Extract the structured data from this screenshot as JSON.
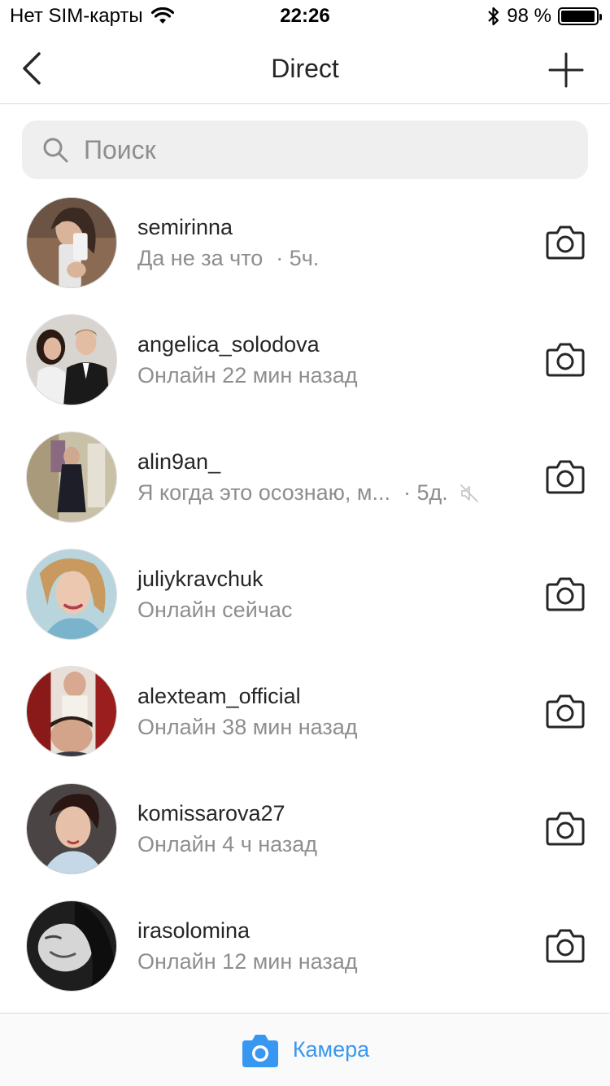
{
  "status_bar": {
    "carrier": "Нет SIM-карты",
    "time": "22:26",
    "battery_text": "98 %",
    "battery_level": 0.98
  },
  "nav": {
    "title": "Direct",
    "back_icon": "chevron-left-icon",
    "add_icon": "plus-icon"
  },
  "search": {
    "placeholder": "Поиск"
  },
  "threads": [
    {
      "name": "semirinna",
      "subtitle": "Да не за что",
      "time": "· 5ч.",
      "muted": false
    },
    {
      "name": "angelica_solodova",
      "subtitle": "Онлайн 22 мин назад",
      "time": "",
      "muted": false
    },
    {
      "name": "alin9an_",
      "subtitle": "Я когда это осознаю, м...",
      "time": "· 5д.",
      "muted": true
    },
    {
      "name": "juliykravchuk",
      "subtitle": "Онлайн сейчас",
      "time": "",
      "muted": false
    },
    {
      "name": "alexteam_official",
      "subtitle": "Онлайн 38 мин назад",
      "time": "",
      "muted": false
    },
    {
      "name": "komissarova27",
      "subtitle": "Онлайн 4 ч назад",
      "time": "",
      "muted": false
    },
    {
      "name": "irasolomina",
      "subtitle": "Онлайн 12 мин назад",
      "time": "",
      "muted": false
    }
  ],
  "bottom": {
    "label": "Камера"
  },
  "colors": {
    "accent": "#3897f0",
    "text_primary": "#262626",
    "text_secondary": "#8e8e8e",
    "search_bg": "#efefef"
  }
}
